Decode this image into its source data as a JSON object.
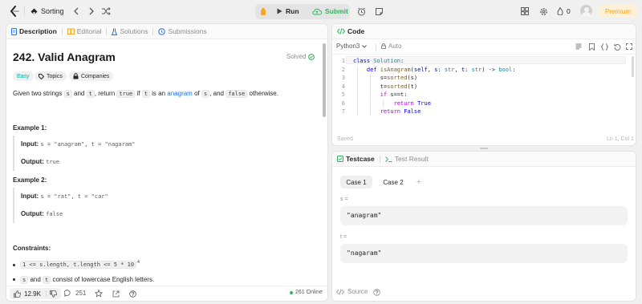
{
  "topbar": {
    "problem_list_label": "Sorting",
    "run_label": "Run",
    "submit_label": "Submit",
    "streak_count": "0",
    "premium_label": "Premium"
  },
  "description": {
    "tabs": [
      {
        "label": "Description"
      },
      {
        "label": "Editorial"
      },
      {
        "label": "Solutions"
      },
      {
        "label": "Submissions"
      }
    ],
    "title": "242. Valid Anagram",
    "status": "Solved",
    "difficulty": "Easy",
    "topics_label": "Topics",
    "companies_label": "Companies",
    "statement": {
      "p1": "Given two strings ",
      "c1": "s",
      "p2": " and ",
      "c2": "t",
      "p3": ", return ",
      "c3": "true",
      "p4": " if ",
      "c4": "t",
      "p5": " is an ",
      "link": "anagram",
      "p6": " of ",
      "c5": "s",
      "p7": ", and ",
      "c6": "false",
      "p8": " otherwise."
    },
    "examples": [
      {
        "title": "Example 1:",
        "input_label": "Input:",
        "input": "s = \"anagram\", t = \"nagaram\"",
        "output_label": "Output:",
        "output": "true"
      },
      {
        "title": "Example 2:",
        "input_label": "Input:",
        "input": "s = \"rat\", t = \"car\"",
        "output_label": "Output:",
        "output": "false"
      }
    ],
    "constraints_title": "Constraints:",
    "constraint1": "1 <= s.length, t.length <= 5 * 10",
    "constraint1_sup": "4",
    "constraint2_a": "s",
    "constraint2_b": " and ",
    "constraint2_c": "t",
    "constraint2_d": " consist of lowercase English letters.",
    "footer": {
      "likes": "12.9K",
      "comments": "251",
      "online": "261 Online"
    }
  },
  "code": {
    "tab_label": "Code",
    "language": "Python3",
    "mode": "Auto",
    "lines": [
      "class Solution:",
      "    def isAnagram(self, s: str, t: str) -> bool:",
      "        s=sorted(s)",
      "        t=sorted(t)",
      "        if s==t:",
      "            return True",
      "        return False"
    ],
    "line_numbers": [
      "1",
      "2",
      "3",
      "4",
      "5",
      "6",
      "7"
    ],
    "saved_label": "Saved",
    "cursor_pos": "Ln 1, Col 1"
  },
  "testcase": {
    "tab_label": "Testcase",
    "result_tab_label": "Test Result",
    "cases": [
      {
        "label": "Case 1"
      },
      {
        "label": "Case 2"
      }
    ],
    "var1_label": "s =",
    "var1_value": "\"anagram\"",
    "var2_label": "t =",
    "var2_value": "\"nagaram\"",
    "source_label": "Source"
  },
  "colors": {
    "accent_green": "#2db55d",
    "link_blue": "#1a73e8",
    "easy_teal": "#00af9b",
    "premium_orange": "#ffa116"
  }
}
